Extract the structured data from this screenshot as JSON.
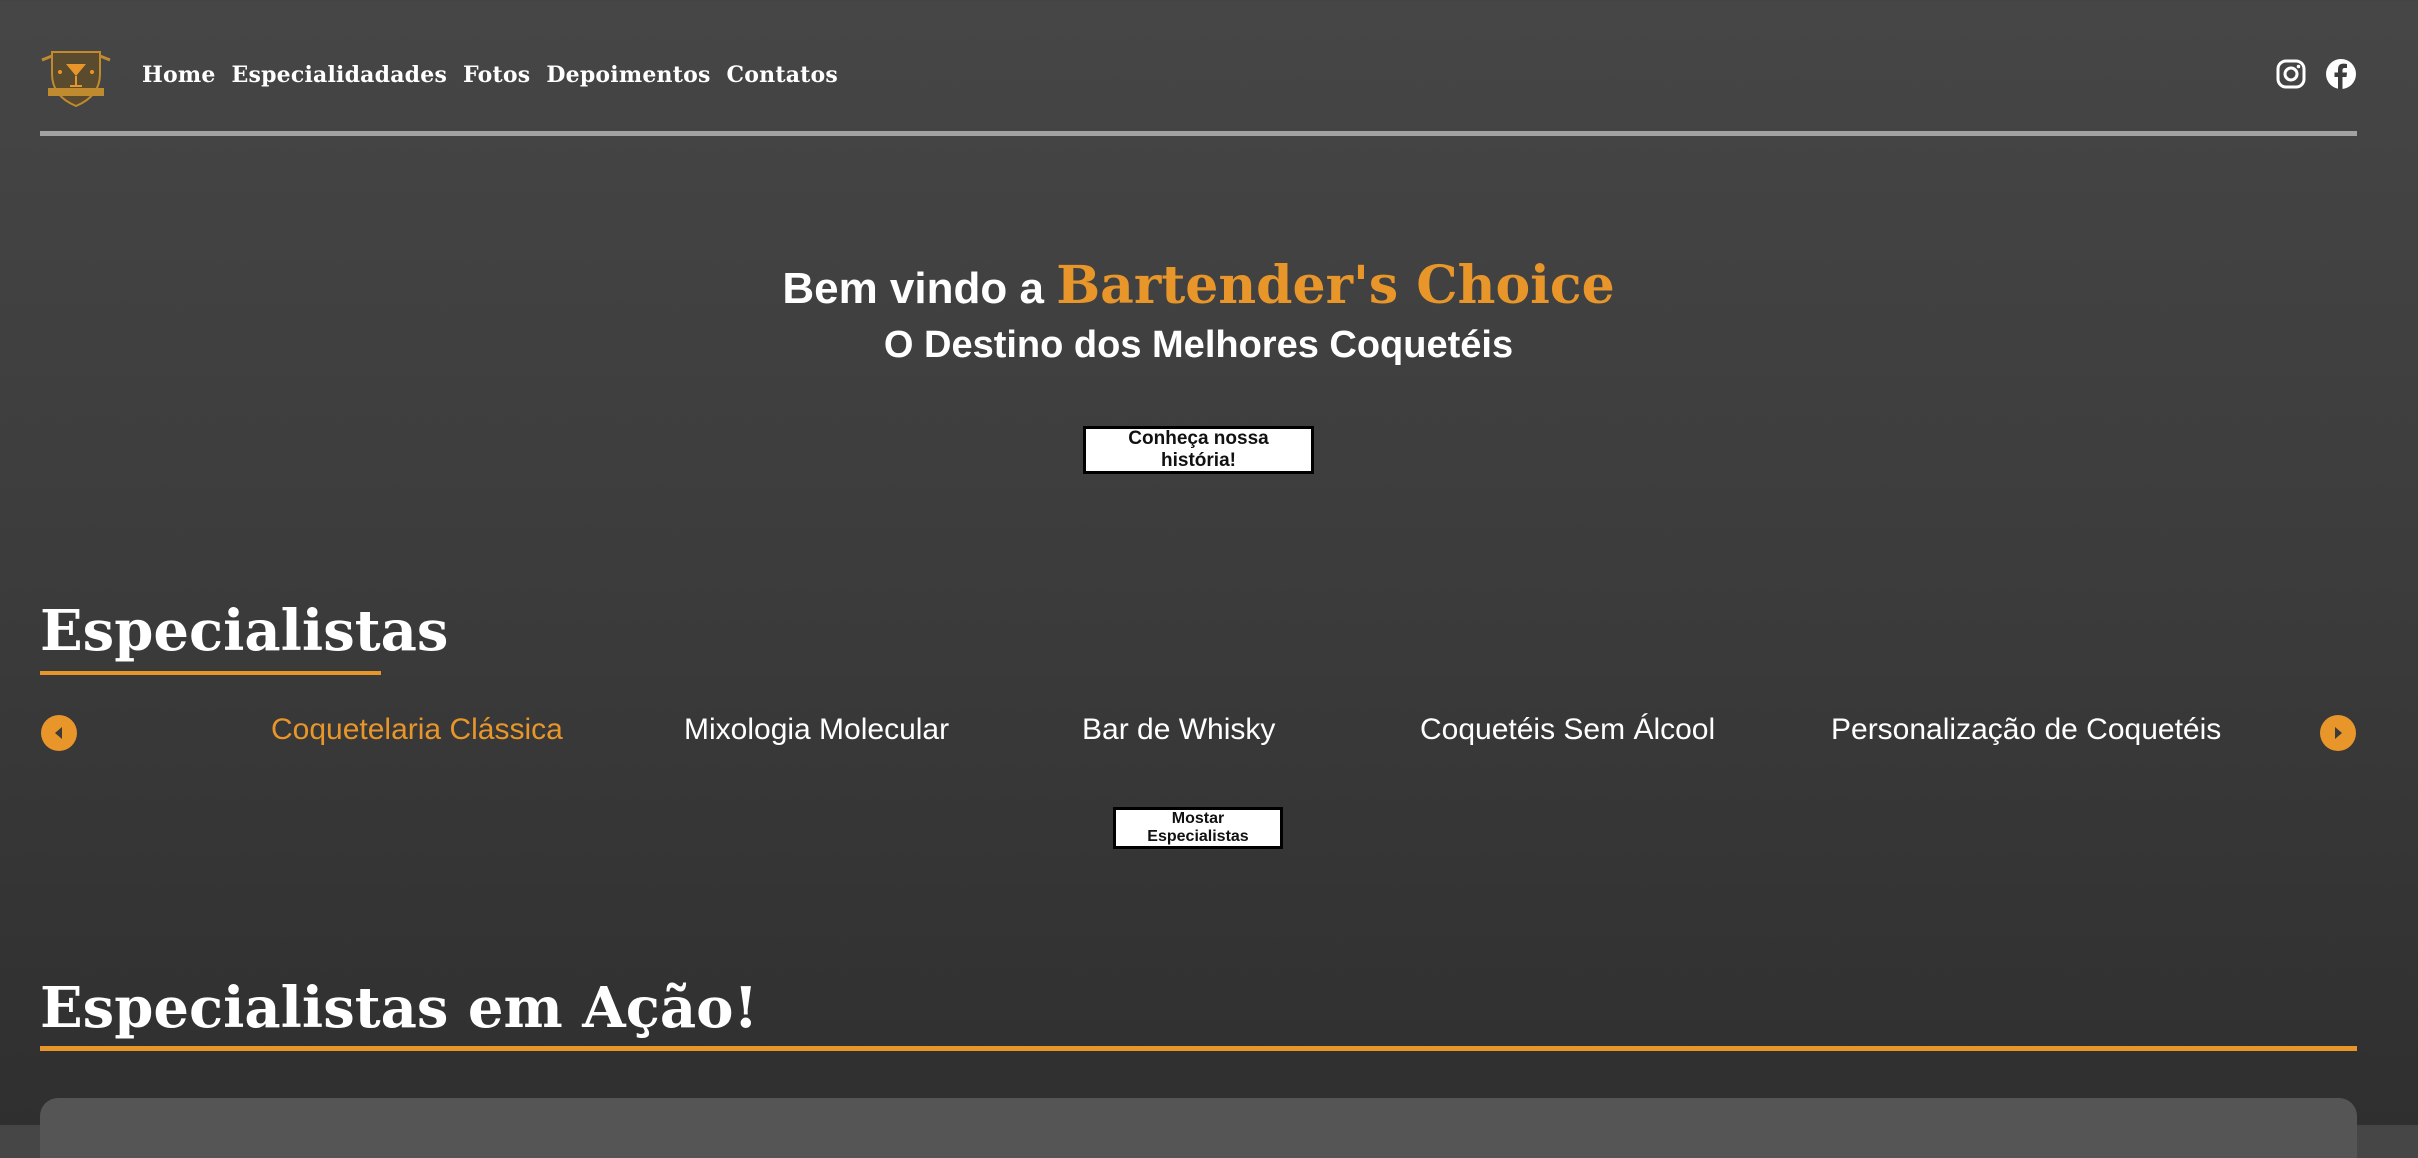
{
  "nav": {
    "links": [
      "Home",
      "Especialidadades",
      "Fotos",
      "Depoimentos",
      "Contatos"
    ]
  },
  "social": {
    "icons": [
      "instagram-icon",
      "facebook-icon"
    ]
  },
  "hero": {
    "line1_prefix": "Bem vindo a",
    "brand": "Bartender's Choice",
    "line2": "O Destino dos Melhores Coquetéis",
    "cta_label": "Conheça nossa história!"
  },
  "especialistas": {
    "title": "Especialistas",
    "items": [
      "Coquetelaria Clássica",
      "Mixologia Molecular",
      "Bar de Whisky",
      "Coquetéis Sem Álcool",
      "Personalização de Coquetéis"
    ],
    "active_index": 0,
    "show_button_label": "Mostar Especialistas"
  },
  "acao": {
    "title": "Especialistas em Ação!"
  },
  "colors": {
    "accent": "#e8962a",
    "divider": "#a2a2a2",
    "panel": "#555555"
  }
}
